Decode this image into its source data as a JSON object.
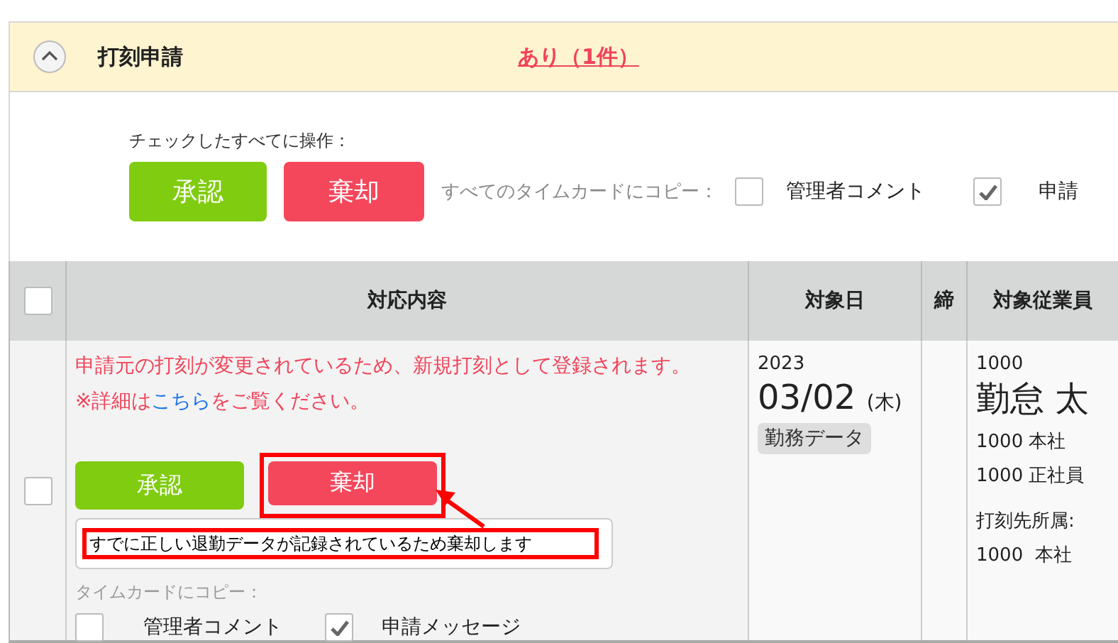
{
  "section": {
    "title": "打刻申請",
    "expanded": true,
    "link": "あり（1件）"
  },
  "bulk": {
    "label": "チェックしたすべてに操作：",
    "approve": "承認",
    "reject": "棄却",
    "copy_label": "すべてのタイムカードにコピー：",
    "copy_options": [
      {
        "label": "管理者コメント",
        "checked": false
      },
      {
        "label": "申請",
        "checked": true
      }
    ]
  },
  "table": {
    "select_all": {
      "checked": false
    },
    "columns": [
      "対応内容",
      "対象日",
      "締",
      "対象従業員"
    ],
    "rows": [
      {
        "selected": false,
        "warning": "申請元の打刻が変更されているため、新規打刻として登録されます。",
        "note_prefix": "※詳細は",
        "note_link": "こちら",
        "note_suffix": "をご覧ください。",
        "approve": "承認",
        "reject": "棄却",
        "reject_highlighted": true,
        "comment": "すでに正しい退勤データが記録されているため棄却します",
        "comment_highlighted": true,
        "copy_label": "タイムカードにコピー：",
        "copy_options": [
          {
            "label": "管理者コメント",
            "checked": false
          },
          {
            "label": "申請メッセージ",
            "checked": true
          }
        ],
        "year": "2023",
        "date": "03/02",
        "weekday": "(木)",
        "tag": "勤務データ",
        "closing": "",
        "employee_code": "1000",
        "employee_name": "勤怠 太",
        "department": "1000 本社",
        "employment": "1000 正社員",
        "punch_label": "打刻先所属:",
        "punch_department": "1000  本社"
      }
    ]
  }
}
